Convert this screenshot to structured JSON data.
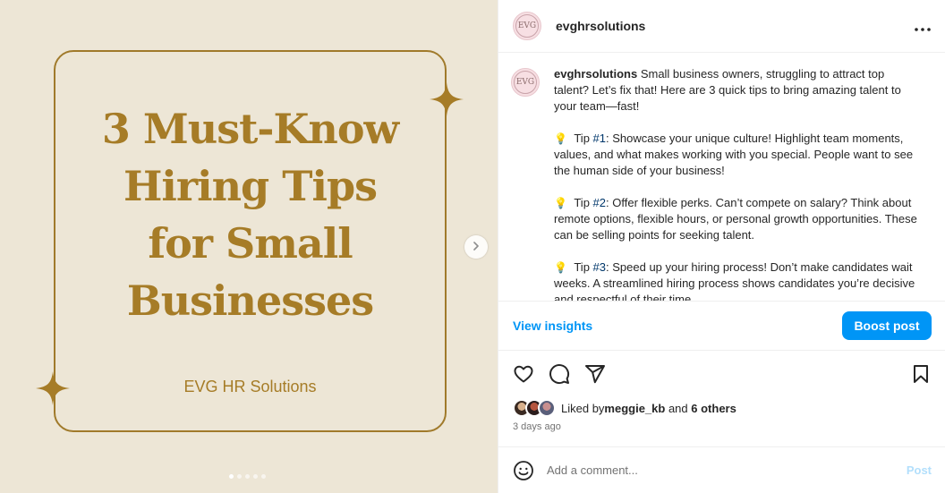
{
  "post": {
    "image": {
      "title_lines": [
        "3 Must-Know",
        "Hiring Tips",
        "for Small",
        "Businesses"
      ],
      "brand": "EVG HR Solutions",
      "slide_count": 5,
      "active_slide": 1,
      "colors": {
        "background": "#ede6d6",
        "gold": "#a67c27"
      }
    },
    "author": {
      "username": "evghrsolutions",
      "avatar_text": "EVG"
    },
    "caption": {
      "intro": "Small business owners, struggling to attract top talent? Let’s fix that! Here are 3 quick tips to bring amazing talent to your team—fast!",
      "tips": [
        {
          "prefix": "Tip ",
          "tag": "#1",
          "text": ": Showcase your unique culture! Highlight team moments, values, and what makes working with you special. People want to see the human side of your business!"
        },
        {
          "prefix": "Tip ",
          "tag": "#2",
          "text": ": Offer flexible perks. Can’t compete on salary? Think about remote options, flexible hours, or personal growth opportunities. These can be selling points for seeking talent."
        },
        {
          "prefix": "Tip ",
          "tag": "#3",
          "text": ": Speed up your hiring process! Don’t make candidates wait weeks. A streamlined hiring process shows candidates you’re decisive and respectful of their time."
        }
      ]
    },
    "insights": {
      "view_label": "View insights",
      "boost_label": "Boost post"
    },
    "likes": {
      "prefix": "Liked by ",
      "first_user": "meggie_kb",
      "middle": " and ",
      "others": "6 others"
    },
    "time_ago": "3 days ago",
    "comment": {
      "placeholder": "Add a comment...",
      "post_label": "Post"
    },
    "icons": {
      "like": "heart-icon",
      "comment": "comment-icon",
      "share": "share-icon",
      "save": "bookmark-icon",
      "emoji": "emoji-icon",
      "more": "more-options-icon",
      "next": "chevron-right-icon"
    },
    "accent_color": "#0095f6"
  }
}
